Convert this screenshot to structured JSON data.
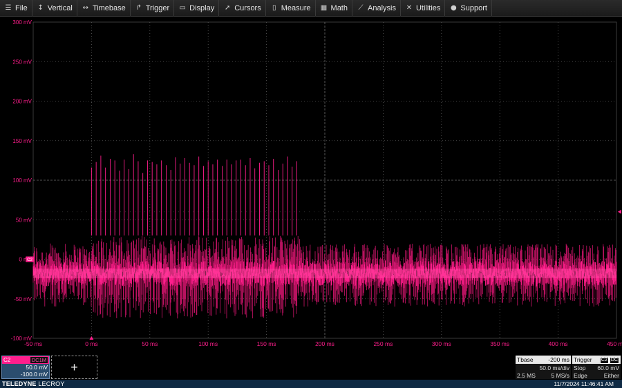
{
  "menu": [
    {
      "label": "File",
      "icon": "menu-icon"
    },
    {
      "label": "Vertical",
      "icon": "vertical-arrows-icon"
    },
    {
      "label": "Timebase",
      "icon": "horizontal-arrows-icon"
    },
    {
      "label": "Trigger",
      "icon": "trigger-icon"
    },
    {
      "label": "Display",
      "icon": "display-icon"
    },
    {
      "label": "Cursors",
      "icon": "cursors-icon"
    },
    {
      "label": "Measure",
      "icon": "measure-icon"
    },
    {
      "label": "Math",
      "icon": "math-icon"
    },
    {
      "label": "Analysis",
      "icon": "analysis-icon"
    },
    {
      "label": "Utilities",
      "icon": "utilities-icon"
    },
    {
      "label": "Support",
      "icon": "support-icon"
    }
  ],
  "colors": {
    "trace": "#ff1e8c",
    "trace_bright": "#ff5aa8",
    "grid": "#5a5a5a",
    "background": "#000000"
  },
  "chart_data": {
    "type": "line",
    "y_unit": "mV",
    "x_unit": "ms",
    "ylim": [
      -100,
      300
    ],
    "xlim": [
      -50,
      450
    ],
    "y_ticks": [
      "300 mV",
      "250 mV",
      "200 mV",
      "150 mV",
      "100 mV",
      "50 mV",
      "0 mV",
      "-50 mV",
      "-100 mV"
    ],
    "x_ticks": [
      "-50 ms",
      "0 ms",
      "50 ms",
      "100 ms",
      "150 ms",
      "200 ms",
      "250 ms",
      "300 ms",
      "350 ms",
      "400 ms",
      "450 ms"
    ],
    "trigger_level": 60,
    "noise_band": {
      "min": -60,
      "max": 20,
      "mean": -18
    },
    "burst": {
      "x_start": 0,
      "x_end": 180,
      "min": -75,
      "max": 30
    },
    "spikes": [
      {
        "x": 0,
        "y": 116
      },
      {
        "x": 4,
        "y": 123
      },
      {
        "x": 8,
        "y": 131
      },
      {
        "x": 12,
        "y": 116
      },
      {
        "x": 16,
        "y": 127
      },
      {
        "x": 20,
        "y": 125
      },
      {
        "x": 24,
        "y": 112
      },
      {
        "x": 28,
        "y": 126
      },
      {
        "x": 32,
        "y": 114
      },
      {
        "x": 36,
        "y": 133
      },
      {
        "x": 40,
        "y": 124
      },
      {
        "x": 44,
        "y": 109
      },
      {
        "x": 48,
        "y": 125
      },
      {
        "x": 52,
        "y": 123
      },
      {
        "x": 56,
        "y": 120
      },
      {
        "x": 60,
        "y": 125
      },
      {
        "x": 64,
        "y": 119
      },
      {
        "x": 68,
        "y": 113
      },
      {
        "x": 72,
        "y": 129
      },
      {
        "x": 76,
        "y": 121
      },
      {
        "x": 80,
        "y": 128
      },
      {
        "x": 84,
        "y": 122
      },
      {
        "x": 88,
        "y": 119
      },
      {
        "x": 92,
        "y": 130
      },
      {
        "x": 96,
        "y": 118
      },
      {
        "x": 100,
        "y": 124
      },
      {
        "x": 104,
        "y": 120
      },
      {
        "x": 108,
        "y": 126
      },
      {
        "x": 112,
        "y": 118
      },
      {
        "x": 116,
        "y": 126
      },
      {
        "x": 120,
        "y": 120
      },
      {
        "x": 124,
        "y": 125
      },
      {
        "x": 128,
        "y": 126
      },
      {
        "x": 132,
        "y": 119
      },
      {
        "x": 136,
        "y": 128
      },
      {
        "x": 140,
        "y": 115
      },
      {
        "x": 144,
        "y": 122
      },
      {
        "x": 148,
        "y": 124
      },
      {
        "x": 152,
        "y": 119
      },
      {
        "x": 156,
        "y": 127
      },
      {
        "x": 160,
        "y": 113
      },
      {
        "x": 164,
        "y": 121
      },
      {
        "x": 168,
        "y": 130
      },
      {
        "x": 172,
        "y": 117
      },
      {
        "x": 176,
        "y": 124
      }
    ]
  },
  "channel": {
    "name": "C2",
    "coupling": "DC1M",
    "scale": "50.0 mV",
    "offset": "-100.0 mV",
    "marker": "C2"
  },
  "add_trace": {
    "symbol": "+"
  },
  "timebase": {
    "label": "Tbase",
    "delay": "-200 ms",
    "per_div": "50.0 ms/div",
    "samples": "2.5 MS",
    "rate": "5 MS/s"
  },
  "trigger": {
    "label": "Trigger",
    "badge1": "C2",
    "badge2": "DC",
    "mode": "Stop",
    "level": "60.0 mV",
    "type": "Edge",
    "slope": "Either"
  },
  "footer": {
    "brand_bold": "TELEDYNE",
    "brand_light": "LECROY",
    "datetime": "11/7/2024 11:46:41 AM"
  }
}
